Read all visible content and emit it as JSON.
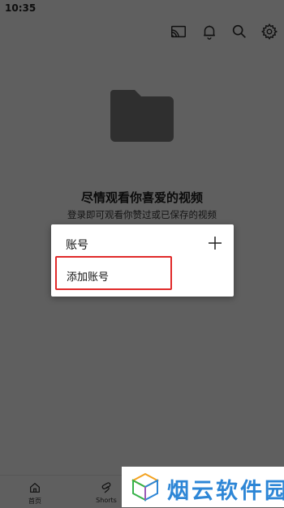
{
  "status_bar": {
    "time": "10:35"
  },
  "top_bar": {
    "icons": [
      "cast-icon",
      "bell-icon",
      "search-icon",
      "gear-icon"
    ]
  },
  "empty_state": {
    "title": "尽情观看你喜爱的视频",
    "subtitle": "登录即可观看你赞过或已保存的视频"
  },
  "account_dialog": {
    "title": "账号",
    "add_account_label": "添加账号"
  },
  "bottom_nav": {
    "items": [
      {
        "label": "首页",
        "icon": "home-icon"
      },
      {
        "label": "Shorts",
        "icon": "shorts-icon"
      }
    ]
  },
  "watermark": {
    "text": "烟云软件园"
  },
  "colors": {
    "background": "#5f5f5f",
    "dialog": "#ffffff",
    "highlight": "#e02a2a",
    "watermark_text": "#2d86d6"
  }
}
